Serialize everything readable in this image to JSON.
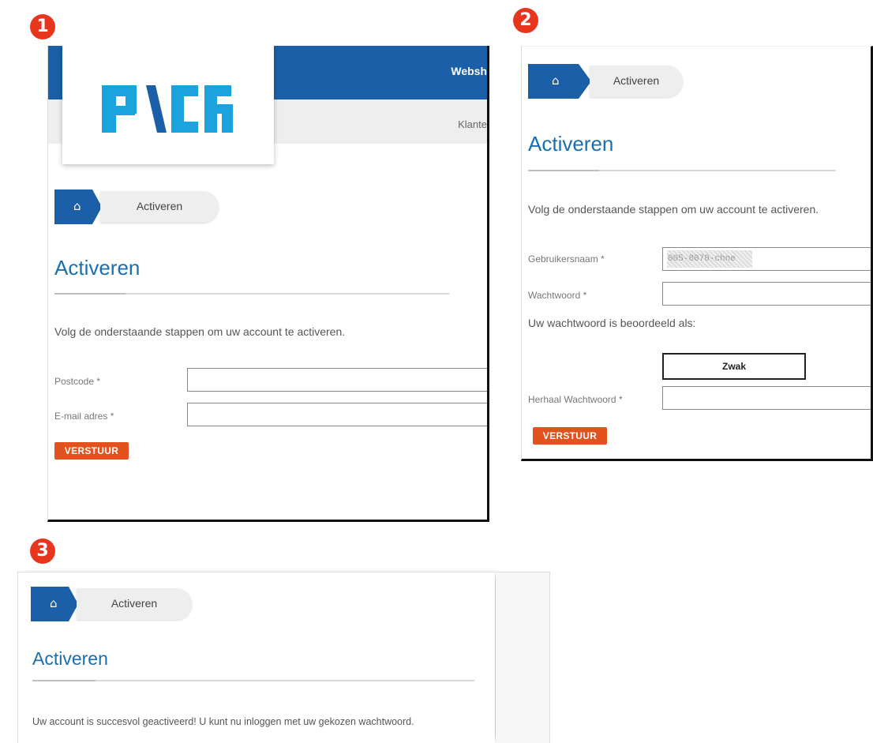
{
  "steps": [
    "1",
    "2",
    "3"
  ],
  "header": {
    "logo_text": "PVCF",
    "nav_top": "Websh",
    "nav_sub": "Klante"
  },
  "breadcrumb": {
    "home_icon": "home-icon",
    "current": "Activeren"
  },
  "panel1": {
    "title": "Activeren",
    "intro": "Volg de onderstaande stappen om uw account te activeren.",
    "postcode_label": "Postcode *",
    "postcode_value": "",
    "email_label": "E-mail adres *",
    "email_value": "",
    "submit": "VERSTUUR"
  },
  "panel2": {
    "title": "Activeren",
    "intro": "Volg de onderstaande stappen om uw account te activeren.",
    "username_label": "Gebruikersnaam *",
    "username_value": "005-8070-chne",
    "password_label": "Wachtwoord *",
    "password_value": "",
    "strength_label": "Uw wachtwoord is beoordeeld als:",
    "strength_value": "Zwak",
    "repeat_label": "Herhaal Wachtwoord *",
    "repeat_value": "",
    "submit": "VERSTUUR"
  },
  "panel3": {
    "title": "Activeren",
    "message": "Uw account is succesvol geactiveerd! U kunt nu inloggen met uw gekozen wachtwoord."
  },
  "colors": {
    "primary": "#1a5fa8",
    "title": "#1a6fb0",
    "button": "#e2521e",
    "badge": "#e8351e",
    "logo": "#1aa3dc"
  }
}
